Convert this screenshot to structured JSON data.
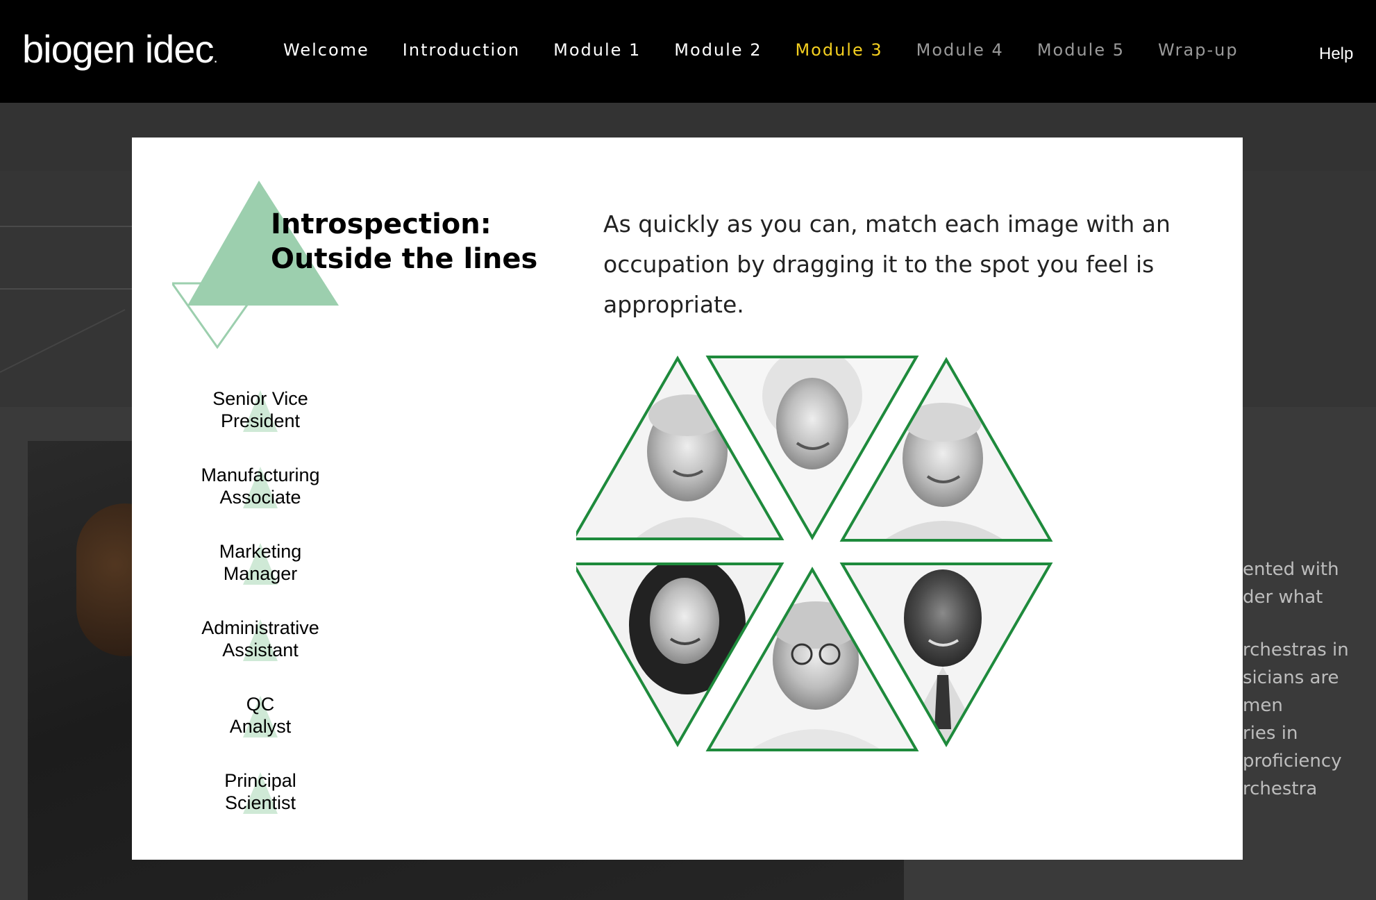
{
  "header": {
    "logo": "biogen idec",
    "logo_mark": ".",
    "nav": [
      {
        "label": "Welcome",
        "state": "normal"
      },
      {
        "label": "Introduction",
        "state": "normal"
      },
      {
        "label": "Module 1",
        "state": "normal"
      },
      {
        "label": "Module 2",
        "state": "normal"
      },
      {
        "label": "Module 3",
        "state": "active"
      },
      {
        "label": "Module 4",
        "state": "disabled"
      },
      {
        "label": "Module 5",
        "state": "disabled"
      },
      {
        "label": "Wrap-up",
        "state": "disabled"
      }
    ],
    "help": "Help"
  },
  "background": {
    "text_lines": [
      "ented with",
      "der what",
      "rchestras in",
      "sicians are",
      "men",
      "ries in",
      "proficiency",
      "rchestra"
    ]
  },
  "modal": {
    "title_line1": "Introspection:",
    "title_line2": "Outside the lines",
    "instructions": "As quickly as you can, match each image with an occupation by dragging it to the spot you feel is appropriate.",
    "occupations": [
      {
        "line1": "Senior Vice",
        "line2": "President"
      },
      {
        "line1": "Manufacturing",
        "line2": "Associate"
      },
      {
        "line1": "Marketing",
        "line2": "Manager"
      },
      {
        "line1": "Administrative",
        "line2": "Assistant"
      },
      {
        "line1": "QC",
        "line2": "Analyst"
      },
      {
        "line1": "Principal",
        "line2": "Scientist"
      }
    ],
    "photos": [
      {
        "label": "older-man-photo"
      },
      {
        "label": "blonde-woman-photo"
      },
      {
        "label": "asian-man-photo"
      },
      {
        "label": "dark-haired-woman-photo"
      },
      {
        "label": "older-woman-glasses-photo"
      },
      {
        "label": "bald-man-tie-photo"
      }
    ]
  },
  "colors": {
    "accent_green": "#1e8a3c",
    "soft_green": "#9ccfae",
    "nav_active": "#f5d020"
  }
}
